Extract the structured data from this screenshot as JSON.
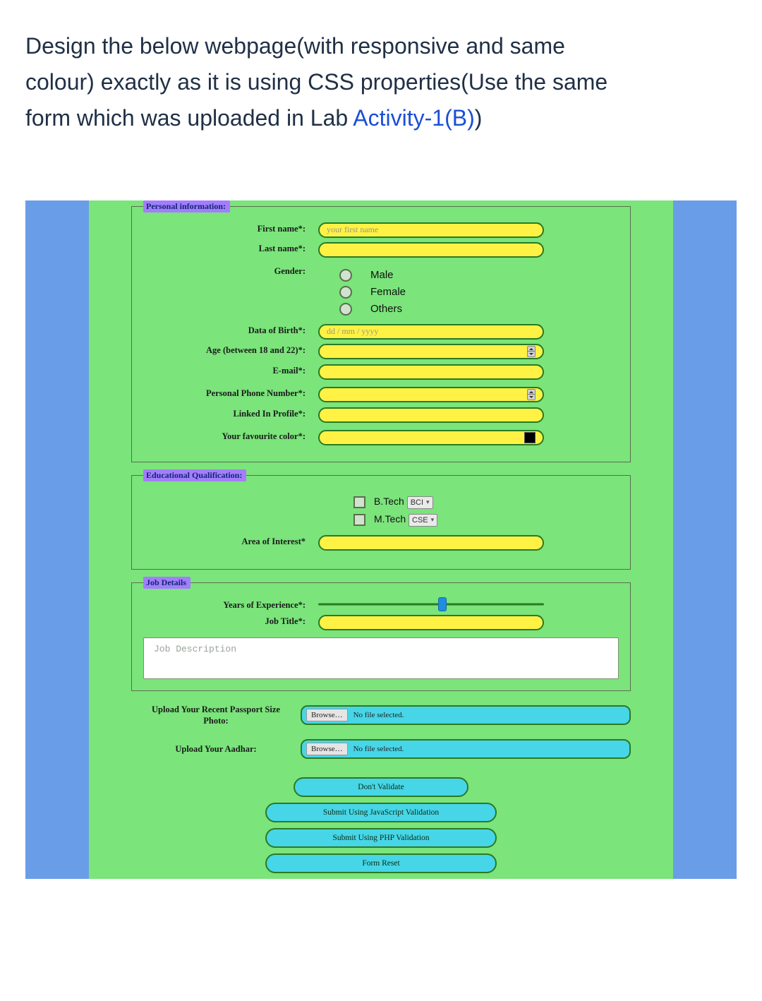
{
  "prompt": {
    "line1_a": "Design the below webpage(with responsive and same",
    "line2_a": "colour) exactly as it is using CSS properties(Use the same",
    "line3_a": "form which was uploaded in Lab ",
    "link": "Activity-1(B)",
    "line3_b": ")"
  },
  "form": {
    "legend_personal": "Personal information:",
    "legend_edu": "Educational Qualification:",
    "legend_job": "Job Details",
    "labels": {
      "first_name": "First name*:",
      "last_name": "Last name*:",
      "gender": "Gender:",
      "dob": "Data of Birth*:",
      "age": "Age (between 18 and 22)*:",
      "email": "E-mail*:",
      "phone": "Personal Phone Number*:",
      "linkedin": "Linked In Profile*:",
      "color": "Your favourite color*:",
      "aoi": "Area of Interest*",
      "yoe": "Years of Experience*:",
      "jobtitle": "Job Title*:",
      "jobdesc": "Job Description",
      "upload_photo_a": "Upload Your Recent Passport Size",
      "upload_photo_b": "Photo:",
      "upload_aadhar": "Upload Your Aadhar:"
    },
    "placeholders": {
      "first_name": "your first name",
      "dob": "dd / mm / yyyy"
    },
    "gender_options": {
      "male": "Male",
      "female": "Female",
      "others": "Others"
    },
    "edu_degrees": {
      "btech_label": "B.Tech",
      "btech_select": "BCI",
      "mtech_label": "M.Tech",
      "mtech_select": "CSE"
    },
    "file_stub": {
      "browse": "Browse…",
      "no_file": "No file selected."
    },
    "buttons": {
      "no_val": "Don't Validate",
      "js_val": "Submit Using JavaScript Validation",
      "php_val": "Submit Using PHP Validation",
      "reset": "Form Reset"
    }
  }
}
